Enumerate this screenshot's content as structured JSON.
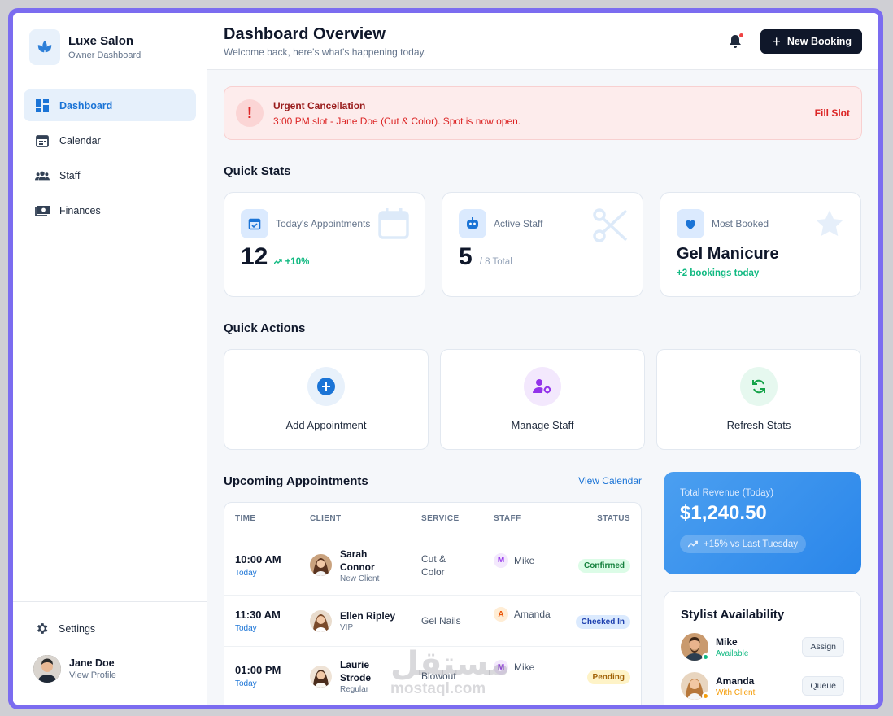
{
  "brand": {
    "name": "Luxe Salon",
    "subtitle": "Owner Dashboard"
  },
  "sidebar": {
    "items": [
      {
        "label": "Dashboard",
        "icon": "dashboard-icon",
        "active": true
      },
      {
        "label": "Calendar",
        "icon": "calendar-icon",
        "active": false
      },
      {
        "label": "Staff",
        "icon": "group-icon",
        "active": false
      },
      {
        "label": "Finances",
        "icon": "money-icon",
        "active": false
      }
    ],
    "settings_label": "Settings",
    "user": {
      "name": "Jane Doe",
      "link": "View Profile"
    }
  },
  "header": {
    "title": "Dashboard Overview",
    "subtitle": "Welcome back, here's what's happening today.",
    "new_booking_label": "New Booking"
  },
  "alert": {
    "title": "Urgent Cancellation",
    "message": "3:00 PM slot - Jane Doe (Cut & Color). Spot is now open.",
    "action": "Fill Slot"
  },
  "quick_stats": {
    "title": "Quick Stats",
    "cards": [
      {
        "label": "Today's Appointments",
        "value": "12",
        "trend": "+10%"
      },
      {
        "label": "Active Staff",
        "value": "5",
        "total": "/ 8 Total"
      },
      {
        "label": "Most Booked",
        "value": "Gel Manicure",
        "sub": "+2 bookings today"
      }
    ]
  },
  "quick_actions": {
    "title": "Quick Actions",
    "items": [
      {
        "label": "Add Appointment"
      },
      {
        "label": "Manage Staff"
      },
      {
        "label": "Refresh Stats"
      }
    ]
  },
  "appointments": {
    "title": "Upcoming Appointments",
    "link": "View Calendar",
    "columns": [
      "TIME",
      "CLIENT",
      "SERVICE",
      "STAFF",
      "STATUS"
    ],
    "rows": [
      {
        "time": "10:00 AM",
        "day": "Today",
        "client_line1": "Sarah",
        "client_line2": "Connor",
        "tag": "New Client",
        "service_line1": "Cut &",
        "service_line2": "Color",
        "staff_initial": "M",
        "staff": "Mike",
        "status": "Confirmed"
      },
      {
        "time": "11:30 AM",
        "day": "Today",
        "client_line1": "Ellen Ripley",
        "client_line2": "",
        "tag": "VIP",
        "service_line1": "Gel Nails",
        "service_line2": "",
        "staff_initial": "A",
        "staff": "Amanda",
        "status": "Checked In"
      },
      {
        "time": "01:00 PM",
        "day": "Today",
        "client_line1": "Laurie",
        "client_line2": "Strode",
        "tag": "Regular",
        "service_line1": "Blowout",
        "service_line2": "",
        "staff_initial": "M",
        "staff": "Mike",
        "status": "Pending"
      }
    ]
  },
  "revenue": {
    "label": "Total Revenue (Today)",
    "value": "$1,240.50",
    "change": "+15% vs Last Tuesday"
  },
  "availability": {
    "title": "Stylist Availability",
    "stylists": [
      {
        "name": "Mike",
        "status": "Available",
        "action": "Assign"
      },
      {
        "name": "Amanda",
        "status": "With Client",
        "action": "Queue"
      }
    ]
  },
  "watermark": {
    "arabic": "مستقل",
    "latin": "mostaql.com"
  },
  "colors": {
    "accent": "#1b74d6",
    "dark": "#0f172a",
    "success": "#10b981",
    "danger": "#dc2626",
    "frame": "#7b6cf0"
  }
}
